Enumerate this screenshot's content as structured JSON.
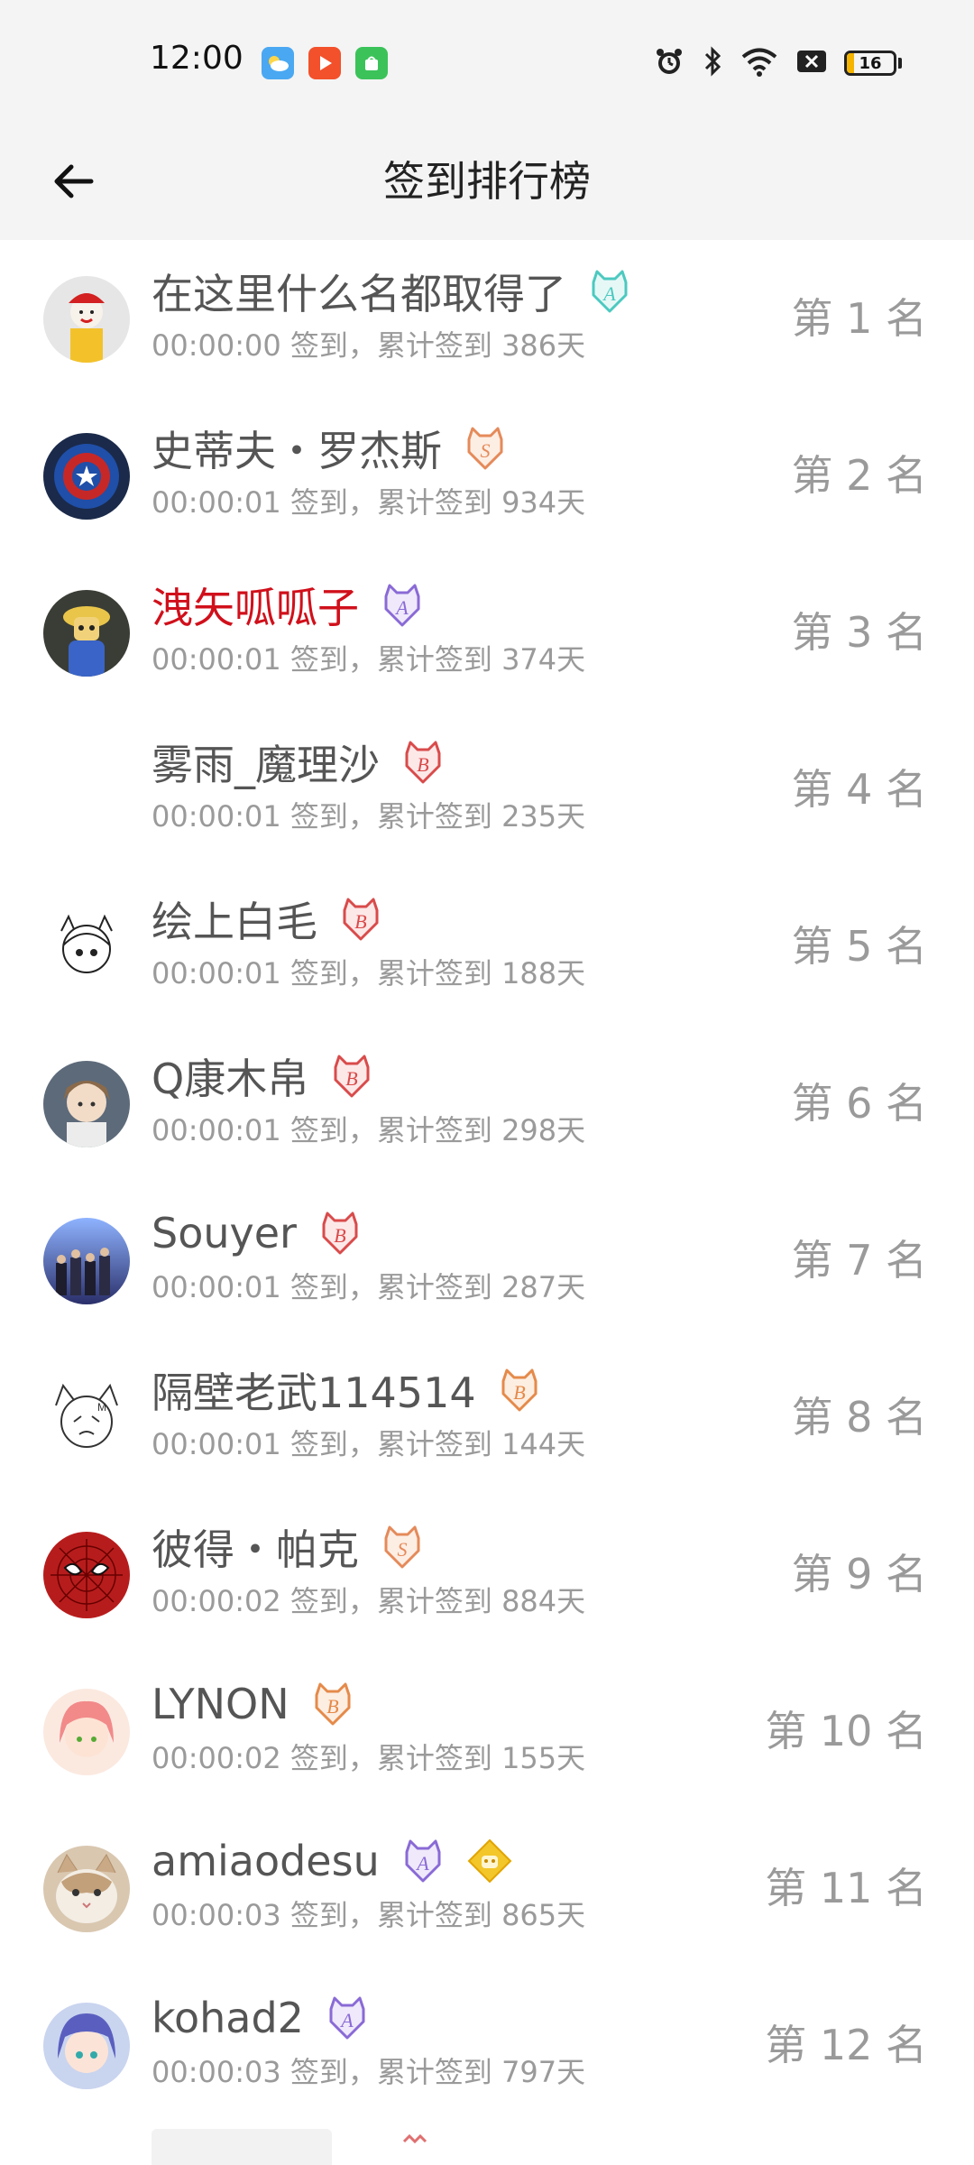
{
  "status_bar": {
    "time": "12:00",
    "battery_level": "16",
    "battery_fraction": 0.16
  },
  "header": {
    "back_icon": "arrow-left-icon",
    "title": "签到排行榜"
  },
  "colors": {
    "name_highlight": "#d0101b",
    "secondary_text": "#9a9a9a",
    "primary_text": "#555555",
    "header_bg": "#f4f4f4"
  },
  "ranking": [
    {
      "name": "在这里什么名都取得了",
      "subtitle": "00:00:00 签到，累计签到 386天",
      "rank_label": "第 1 名",
      "badges": [
        "cat-badge-a-teal"
      ],
      "avatar": "mascot-avatar",
      "highlight": false
    },
    {
      "name": "史蒂夫・罗杰斯",
      "subtitle": "00:00:01 签到，累计签到 934天",
      "rank_label": "第 2 名",
      "badges": [
        "cat-badge-s-orange"
      ],
      "avatar": "shield-avatar",
      "highlight": false
    },
    {
      "name": "洩矢呱呱子",
      "subtitle": "00:00:01 签到，累计签到 374天",
      "rank_label": "第 3 名",
      "badges": [
        "cat-badge-a-purple"
      ],
      "avatar": "hat-figure-avatar",
      "highlight": true
    },
    {
      "name": "雾雨_魔理沙",
      "subtitle": "00:00:01 签到，累计签到 235天",
      "rank_label": "第 4 名",
      "badges": [
        "cat-badge-b-red"
      ],
      "avatar": "blank-avatar",
      "highlight": false
    },
    {
      "name": "绘上白毛",
      "subtitle": "00:00:01 签到，累计签到 188天",
      "rank_label": "第 5 名",
      "badges": [
        "cat-badge-b-red"
      ],
      "avatar": "sketch-girl-avatar",
      "highlight": false
    },
    {
      "name": "Q康木帛",
      "subtitle": "00:00:01 签到，累计签到 298天",
      "rank_label": "第 6 名",
      "badges": [
        "cat-badge-b-red"
      ],
      "avatar": "brown-hair-avatar",
      "highlight": false
    },
    {
      "name": "Souyer",
      "subtitle": "00:00:01 签到，累计签到 287天",
      "rank_label": "第 7 名",
      "badges": [
        "cat-badge-b-red"
      ],
      "avatar": "group-scene-avatar",
      "highlight": false
    },
    {
      "name": "隔壁老武114514",
      "subtitle": "00:00:01 签到，累计签到 144天",
      "rank_label": "第 8 名",
      "badges": [
        "cat-badge-b-orange"
      ],
      "avatar": "manga-face-avatar",
      "highlight": false
    },
    {
      "name": "彼得・帕克",
      "subtitle": "00:00:02 签到，累计签到 884天",
      "rank_label": "第 9 名",
      "badges": [
        "cat-badge-s-orange"
      ],
      "avatar": "spider-mask-avatar",
      "highlight": false
    },
    {
      "name": "LYNON",
      "subtitle": "00:00:02 签到，累计签到 155天",
      "rank_label": "第 10 名",
      "badges": [
        "cat-badge-b-orange"
      ],
      "avatar": "pink-hair-avatar",
      "highlight": false
    },
    {
      "name": "amiaodesu",
      "subtitle": "00:00:03 签到，累计签到 865天",
      "rank_label": "第 11 名",
      "badges": [
        "cat-badge-a-purple",
        "gold-diamond-badge"
      ],
      "avatar": "cat-avatar",
      "highlight": false
    },
    {
      "name": "kohad2",
      "subtitle": "00:00:03 签到，累计签到 797天",
      "rank_label": "第 12 名",
      "badges": [
        "cat-badge-a-purple"
      ],
      "avatar": "blue-hair-avatar",
      "highlight": false
    }
  ]
}
